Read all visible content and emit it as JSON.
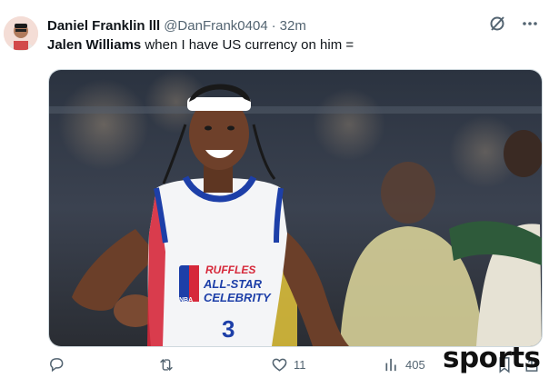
{
  "tweet": {
    "author_name": "Daniel Franklin lll",
    "handle": "@DanFrank0404",
    "separator": "·",
    "time": "32m",
    "mention": "Jalen Williams",
    "text_rest": "when I have US currency on him ="
  },
  "media": {
    "jersey_brand": "RUFFLES",
    "jersey_line1": "ALL-STAR",
    "jersey_line2": "CELEBRITY",
    "jersey_number": "3",
    "jersey_league": "NBA"
  },
  "actions": {
    "reply_icon": "reply-icon",
    "retweet_icon": "retweet-icon",
    "like_icon": "heart-icon",
    "like_count": "11",
    "views_icon": "views-icon",
    "views_count": "405",
    "bookmark_icon": "bookmark-icon",
    "share_icon": "share-icon"
  },
  "watermark": "sports",
  "colors": {
    "text_primary": "#0f1419",
    "text_secondary": "#536471",
    "jersey_blue": "#1d3fa8",
    "jersey_red": "#d6283a",
    "headband": "#ffffff"
  }
}
